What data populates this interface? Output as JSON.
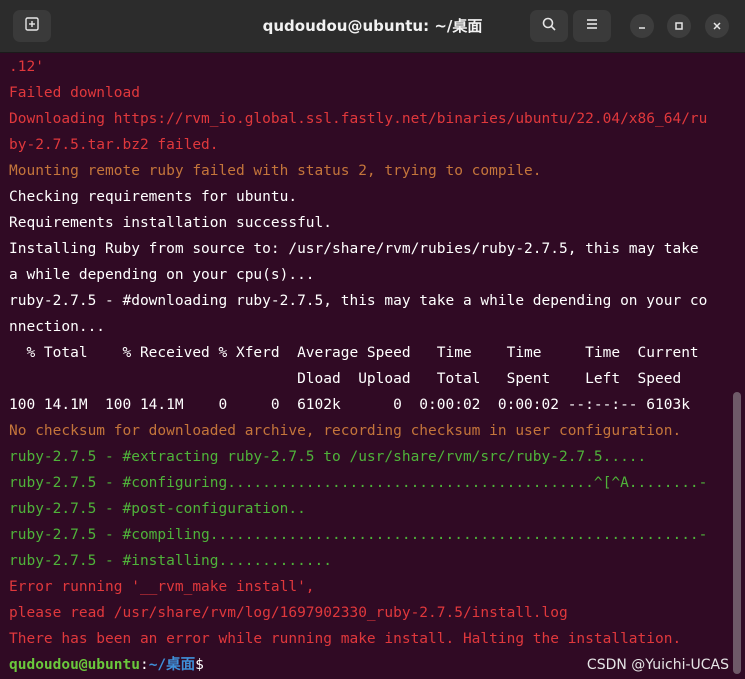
{
  "window": {
    "title": "qudoudou@ubuntu: ~/桌面",
    "icons": {
      "new_tab": "new-tab-icon",
      "search": "search-icon",
      "menu": "hamburger-menu-icon",
      "minimize": "minimize-icon",
      "maximize": "maximize-icon",
      "close": "close-icon"
    }
  },
  "terminal": {
    "lines": [
      ".12'",
      "Failed download",
      "Downloading https://rvm_io.global.ssl.fastly.net/binaries/ubuntu/22.04/x86_64/ru",
      "by-2.7.5.tar.bz2 failed.",
      "Mounting remote ruby failed with status 2, trying to compile.",
      "Checking requirements for ubuntu.",
      "Requirements installation successful.",
      "Installing Ruby from source to: /usr/share/rvm/rubies/ruby-2.7.5, this may take",
      "a while depending on your cpu(s)...",
      "ruby-2.7.5 - #downloading ruby-2.7.5, this may take a while depending on your co",
      "nnection...",
      "  % Total    % Received % Xferd  Average Speed   Time    Time     Time  Current",
      "                                 Dload  Upload   Total   Spent    Left  Speed",
      "100 14.1M  100 14.1M    0     0  6102k      0  0:00:02  0:00:02 --:--:-- 6103k",
      "No checksum for downloaded archive, recording checksum in user configuration.",
      "ruby-2.7.5 - #extracting ruby-2.7.5 to /usr/share/rvm/src/ruby-2.7.5.....",
      "ruby-2.7.5 - #configuring..........................................^[^A........-",
      "ruby-2.7.5 - #post-configuration..",
      "ruby-2.7.5 - #compiling........................................................-",
      "ruby-2.7.5 - #installing.............",
      "Error running '__rvm_make install',",
      "please read /usr/share/rvm/log/1697902330_ruby-2.7.5/install.log",
      "There has been an error while running make install. Halting the installation."
    ],
    "prompt": {
      "user": "qudoudou@ubuntu",
      "sep": ":",
      "path": "~/桌面",
      "symbol": "$"
    }
  },
  "watermark": "CSDN @Yuichi-UCAS",
  "colors": {
    "background": "#300a24",
    "error_red": "#e0383c",
    "warn_orange": "#c4753b",
    "green": "#4fb33a",
    "prompt_user": "#6ac83c",
    "prompt_path": "#3f8fd8"
  }
}
